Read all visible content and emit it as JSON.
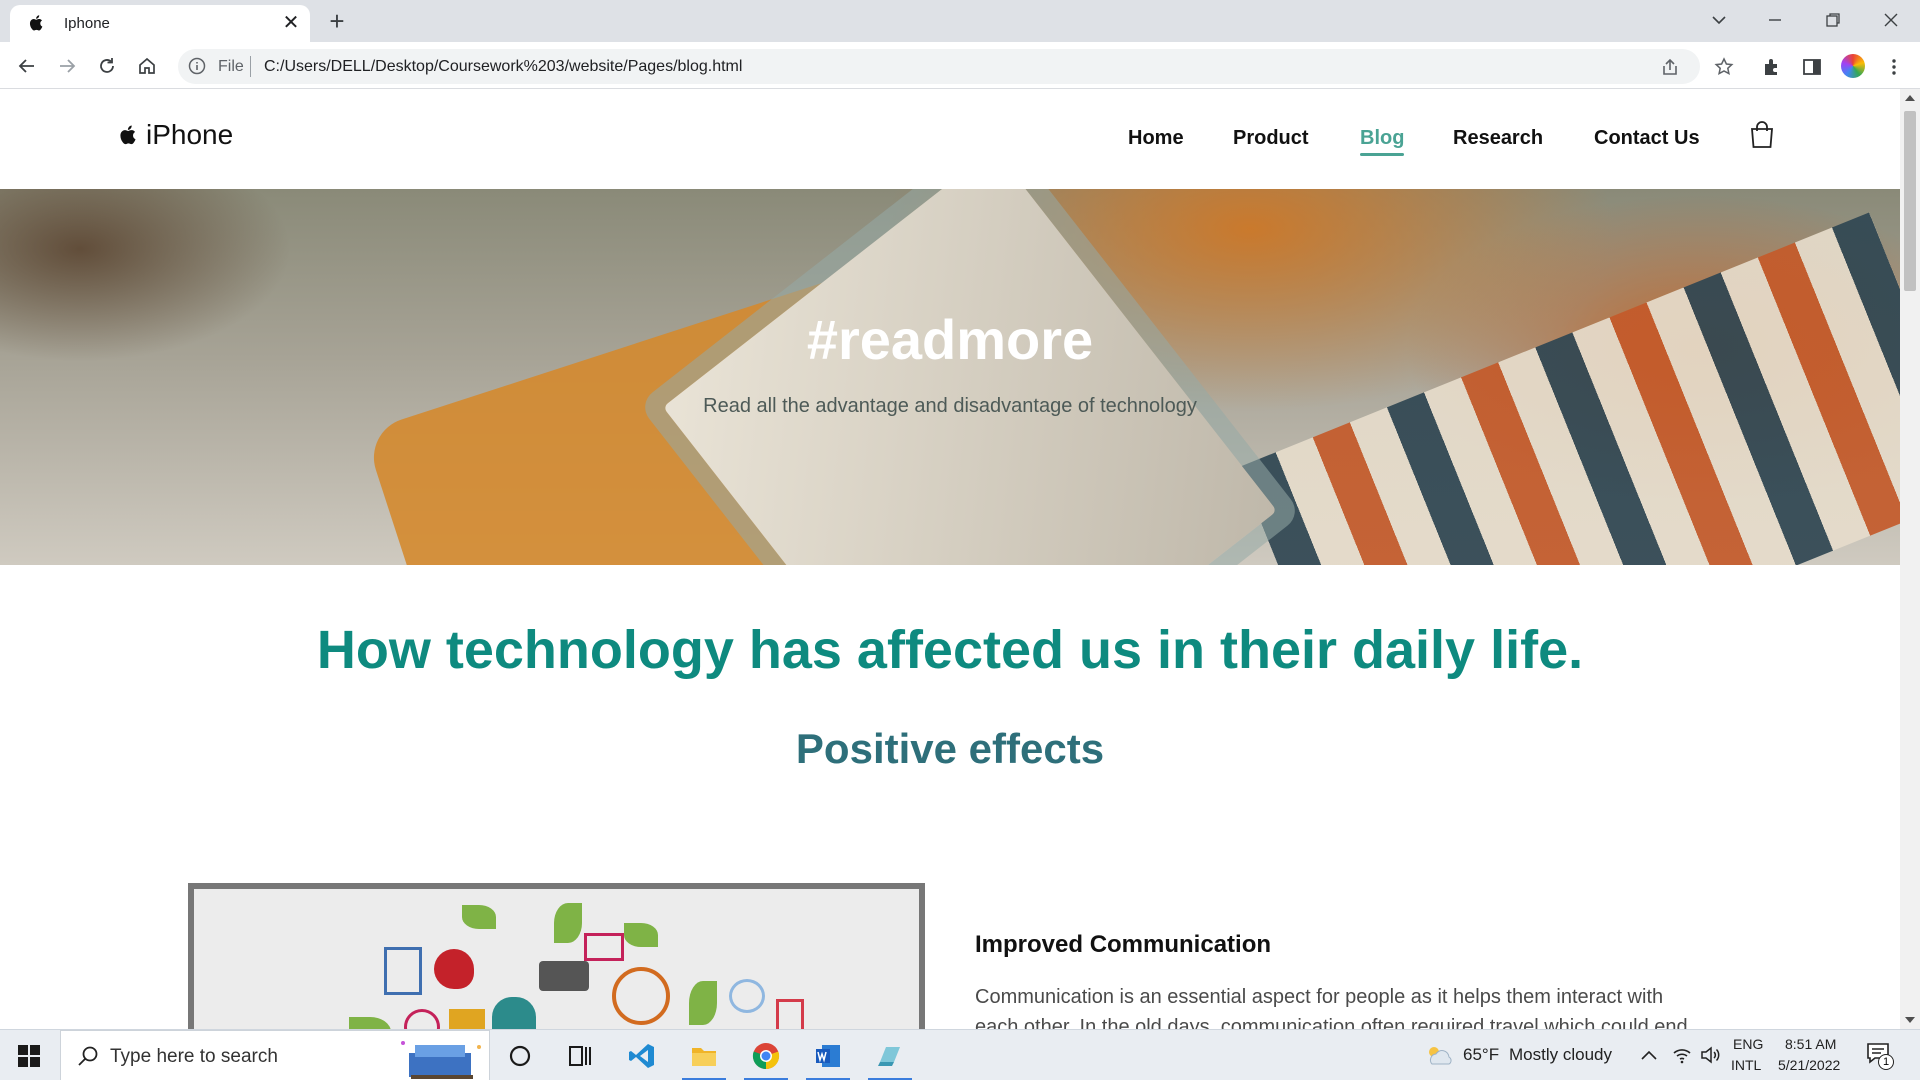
{
  "browser": {
    "tab_title": "Iphone",
    "close_glyph": "✕",
    "new_tab_glyph": "+",
    "omnibox_scheme": "File",
    "url": "C:/Users/DELL/Desktop/Coursework%203/website/Pages/blog.html"
  },
  "site": {
    "brand": "iPhone",
    "nav": [
      "Home",
      "Product",
      "Blog",
      "Research",
      "Contact Us"
    ],
    "active_nav": "Blog",
    "hero_title": "#readmore",
    "hero_subtitle": "Read all the advantage and disadvantage of technology",
    "main_heading": "How technology has affected us in their daily life.",
    "section_heading": "Positive effects",
    "article": {
      "title": "Improved Communication",
      "body": "Communication is an essential aspect for people as it helps them interact with each other. In the old days, communication often required travel which could end"
    }
  },
  "taskbar": {
    "search_placeholder": "Type here to search",
    "weather_temp": "65°F",
    "weather_text": "Mostly cloudy",
    "lang_line1": "ENG",
    "lang_line2": "INTL",
    "time": "8:51 AM",
    "date": "5/21/2022",
    "notification_count": "1"
  },
  "colors": {
    "accent": "#0e8a7f",
    "nav_active": "#4aa394",
    "section_heading": "#2e6f7a"
  },
  "icons": [
    "apple-icon",
    "close-icon",
    "plus-icon",
    "back-icon",
    "forward-icon",
    "reload-icon",
    "home-icon",
    "info-icon",
    "share-icon",
    "star-icon",
    "extensions-icon",
    "sidepanel-icon",
    "menu-icon",
    "cart-icon",
    "windows-icon",
    "search-icon",
    "cortana-icon",
    "taskview-icon",
    "vscode-icon",
    "explorer-icon",
    "chrome-icon",
    "word-icon",
    "app-icon",
    "weather-icon",
    "chevron-up-icon",
    "wifi-icon",
    "volume-icon",
    "notification-icon"
  ]
}
